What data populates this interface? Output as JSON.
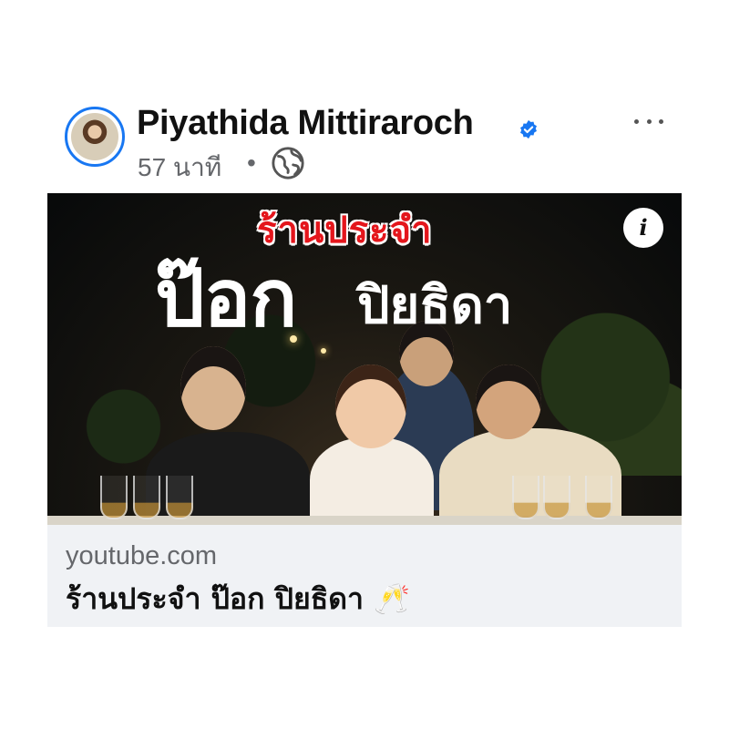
{
  "post": {
    "author_name": "Piyathida Mittiraroch",
    "time": "57 นาที",
    "separator": "•",
    "audience_icon": "globe-icon",
    "verified_icon": "verified-badge-icon",
    "more_icon": "more-options-icon"
  },
  "video": {
    "kicker": "ร้านประจำ",
    "title_main": "ป๊อก",
    "title_name": "ปิยธิดา",
    "info_label": "i"
  },
  "link": {
    "domain": "youtube.com",
    "title": "ร้านประจำ ป๊อก ปิยธิดา 🥂"
  },
  "colors": {
    "accent": "#1877f2",
    "kicker_red": "#e4161c",
    "footer_bg": "#f0f2f5",
    "secondary_text": "#65676b"
  }
}
